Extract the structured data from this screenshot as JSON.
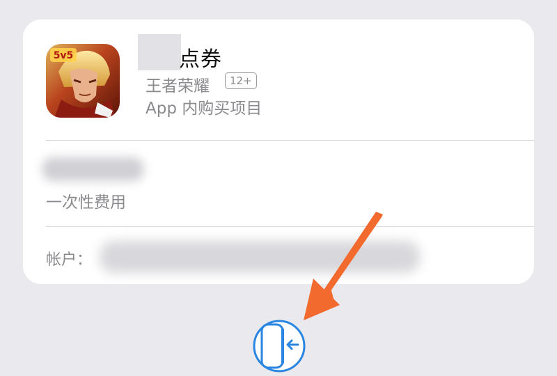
{
  "purchase": {
    "product_title": "点券",
    "app_name": "王者荣耀",
    "age_rating": "12+",
    "iap_label": "App 内购买项目",
    "app_icon_badge": "5v5"
  },
  "price": {
    "fee_type": "一次性费用"
  },
  "account": {
    "label": "帐户："
  },
  "colors": {
    "accent_blue": "#2a86e0",
    "annotation_orange": "#f26a2e"
  },
  "icons": {
    "side_button": "side-button-double-click-icon"
  }
}
